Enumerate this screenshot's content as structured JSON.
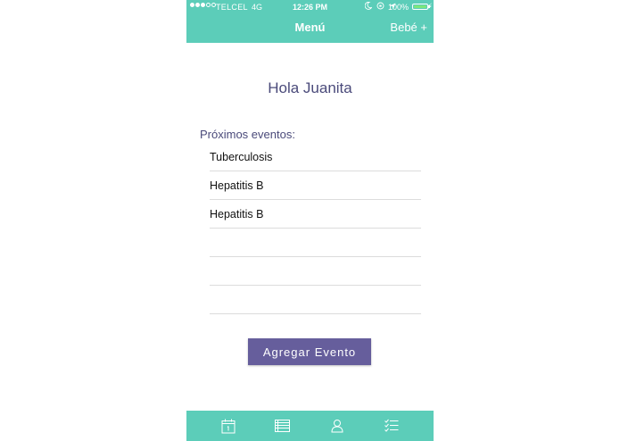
{
  "status_bar": {
    "carrier": "TELCEL",
    "network": "4G",
    "time": "12:26 PM",
    "battery": "100%"
  },
  "nav": {
    "title": "Menú",
    "right_action": "Bebé +"
  },
  "greeting": "Hola Juanita",
  "events": {
    "label": "Próximos eventos:",
    "items": [
      "Tuberculosis",
      "Hepatitis B",
      "Hepatitis B",
      "",
      "",
      ""
    ]
  },
  "add_button_label": "Agregar Evento",
  "tabs": [
    {
      "icon": "calendar-icon"
    },
    {
      "icon": "list-icon"
    },
    {
      "icon": "profile-icon"
    },
    {
      "icon": "checklist-icon"
    }
  ],
  "colors": {
    "teal": "#5ccdb9",
    "purple_button": "#665e9c",
    "heading_text": "#4a4a7a"
  }
}
